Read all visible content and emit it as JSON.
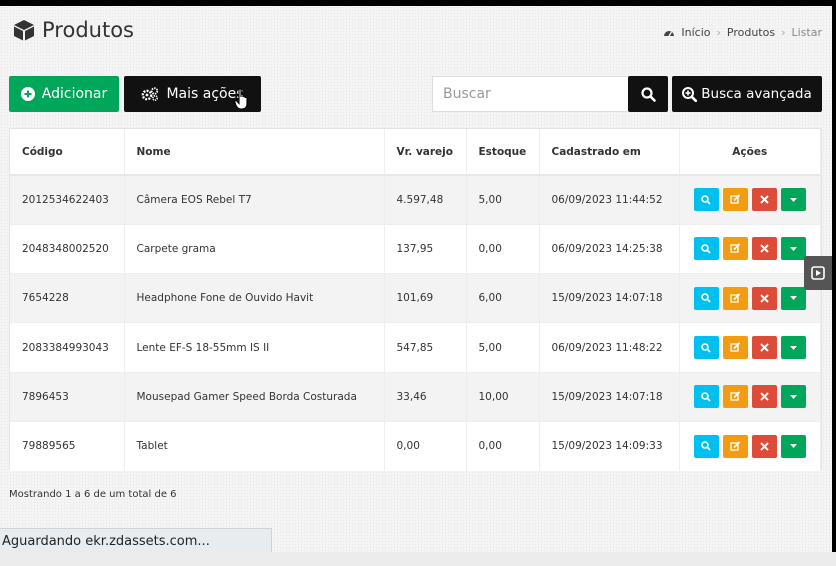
{
  "header": {
    "title": "Produtos",
    "breadcrumb": [
      "Início",
      "Produtos",
      "Listar"
    ]
  },
  "toolbar": {
    "add_label": "Adicionar",
    "more_label": "Mais ações",
    "search_placeholder": "Buscar",
    "advanced_label": "Busca avançada"
  },
  "table": {
    "columns": [
      "Código",
      "Nome",
      "Vr. varejo",
      "Estoque",
      "Cadastrado em",
      "Ações"
    ],
    "rows": [
      {
        "codigo": "2012534622403",
        "nome": "Câmera EOS Rebel T7",
        "varejo": "4.597,48",
        "estoque": "5,00",
        "cadastrado": "06/09/2023 11:44:52"
      },
      {
        "codigo": "2048348002520",
        "nome": "Carpete grama",
        "varejo": "137,95",
        "estoque": "0,00",
        "cadastrado": "06/09/2023 14:25:38"
      },
      {
        "codigo": "7654228",
        "nome": "Headphone Fone de Ouvido Havit",
        "varejo": "101,69",
        "estoque": "6,00",
        "cadastrado": "15/09/2023 14:07:18"
      },
      {
        "codigo": "2083384993043",
        "nome": "Lente EF-S 18-55mm IS II",
        "varejo": "547,85",
        "estoque": "5,00",
        "cadastrado": "06/09/2023 11:48:22"
      },
      {
        "codigo": "7896453",
        "nome": "Mousepad Gamer Speed Borda Costurada",
        "varejo": "33,46",
        "estoque": "10,00",
        "cadastrado": "15/09/2023 14:07:18"
      },
      {
        "codigo": "79889565",
        "nome": "Tablet",
        "varejo": "0,00",
        "estoque": "0,00",
        "cadastrado": "15/09/2023 14:09:33"
      }
    ]
  },
  "footer": {
    "info": "Mostrando 1 a 6 de um total de 6"
  },
  "status_bar": {
    "text": "Aguardando ekr.zdassets.com..."
  },
  "icons": {
    "title": "cube-icon",
    "breadcrumb_home": "dashboard-icon",
    "add": "plus-circle-icon",
    "more": "gears-icon",
    "search": "search-icon",
    "advanced": "zoom-in-icon",
    "row_view": "search-icon",
    "row_edit": "edit-icon",
    "row_delete": "close-icon",
    "row_dropdown": "caret-down-icon",
    "side_toggle": "play-square-icon"
  },
  "colors": {
    "success": "#00a65a",
    "info": "#00c0ef",
    "warning": "#f39c12",
    "danger": "#dd4b39",
    "dark": "#111111"
  }
}
